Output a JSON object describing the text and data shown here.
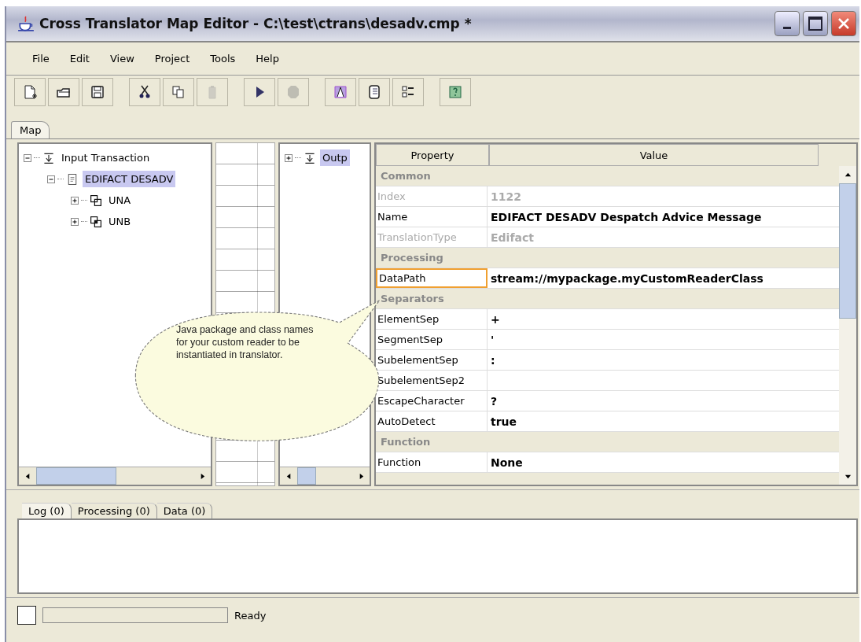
{
  "window": {
    "title": "Cross Translator Map Editor - C:\\test\\ctrans\\desadv.cmp *"
  },
  "menu": [
    "File",
    "Edit",
    "View",
    "Project",
    "Tools",
    "Help"
  ],
  "toolbar": [
    {
      "kind": "new",
      "disabled": false
    },
    {
      "kind": "open",
      "disabled": false
    },
    {
      "kind": "save",
      "disabled": false
    },
    {
      "kind": "sep"
    },
    {
      "kind": "cut",
      "disabled": false
    },
    {
      "kind": "copy",
      "disabled": false
    },
    {
      "kind": "paste",
      "disabled": true
    },
    {
      "kind": "sep"
    },
    {
      "kind": "run",
      "disabled": false
    },
    {
      "kind": "stop",
      "disabled": true
    },
    {
      "kind": "sep"
    },
    {
      "kind": "map",
      "disabled": false
    },
    {
      "kind": "book",
      "disabled": false
    },
    {
      "kind": "list",
      "disabled": false
    },
    {
      "kind": "sep"
    },
    {
      "kind": "help",
      "disabled": false
    }
  ],
  "tabs": [
    {
      "label": "Map",
      "selected": true
    }
  ],
  "input_tree": [
    {
      "label": "Input Transaction",
      "expanded": true,
      "selected": false,
      "children": [
        {
          "label": "EDIFACT DESADV",
          "expanded": true,
          "selected": true,
          "children": [
            {
              "label": "UNA",
              "expanded": false,
              "selected": false
            },
            {
              "label": "UNB",
              "expanded": false,
              "selected": false
            }
          ]
        }
      ]
    }
  ],
  "output_tree": [
    {
      "label": "Outp",
      "expanded": false,
      "selected": true
    }
  ],
  "properties": {
    "columns": [
      "Property",
      "Value"
    ],
    "rows": [
      {
        "kind": "group",
        "label": "Common"
      },
      {
        "kind": "property",
        "name": "Index",
        "value": "1122",
        "disabled": true,
        "selected": false
      },
      {
        "kind": "property",
        "name": "Name",
        "value": "EDIFACT DESADV  Despatch Advice Message",
        "disabled": false,
        "selected": false
      },
      {
        "kind": "property",
        "name": "TranslationType",
        "value": "Edifact",
        "disabled": true,
        "selected": false
      },
      {
        "kind": "group",
        "label": "Processing"
      },
      {
        "kind": "property",
        "name": "DataPath",
        "value": "stream://mypackage.myCustomReaderClass",
        "disabled": false,
        "selected": true
      },
      {
        "kind": "group",
        "label": "Separators"
      },
      {
        "kind": "property",
        "name": "ElementSep",
        "value": "+",
        "disabled": false,
        "selected": false
      },
      {
        "kind": "property",
        "name": "SegmentSep",
        "value": "'",
        "disabled": false,
        "selected": false
      },
      {
        "kind": "property",
        "name": "SubelementSep",
        "value": ":",
        "disabled": false,
        "selected": false
      },
      {
        "kind": "property",
        "name": "SubelementSep2",
        "disabled": false,
        "selected": false
      },
      {
        "kind": "property",
        "name": "EscapeCharacter",
        "value": "?",
        "disabled": false,
        "selected": false
      },
      {
        "kind": "property",
        "name": "AutoDetect",
        "value": "true",
        "disabled": false,
        "selected": false
      },
      {
        "kind": "group",
        "label": "Function"
      },
      {
        "kind": "property",
        "name": "Function",
        "value": "None",
        "disabled": false,
        "selected": false
      }
    ]
  },
  "callout": {
    "text": "Java package and class names for your custom reader to be instantiated in translator."
  },
  "bottom_tabs": [
    {
      "label": "Log (0)",
      "selected": true
    },
    {
      "label": "Processing (0)",
      "selected": false
    },
    {
      "label": "Data (0)",
      "selected": false
    }
  ],
  "status_bar": {
    "progress": {
      "level": 0
    },
    "text": "Ready"
  }
}
